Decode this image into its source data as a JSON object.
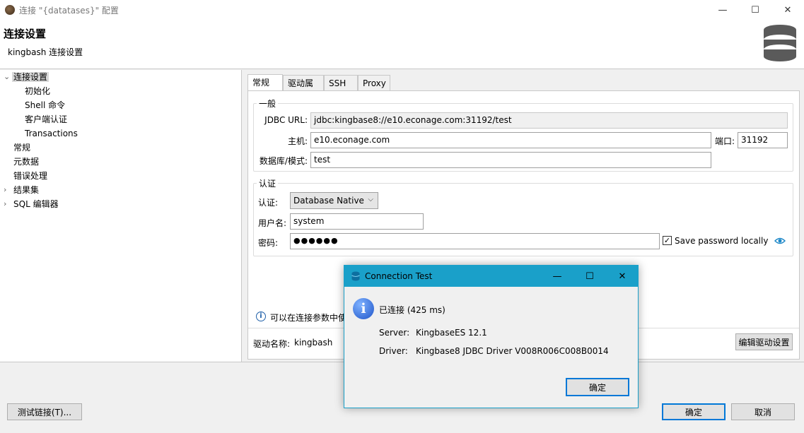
{
  "window": {
    "title": "连接 \"{datatases}\" 配置",
    "minimize": "—",
    "maximize": "☐",
    "close": "✕"
  },
  "header": {
    "title": "连接设置",
    "subtitle": "kingbash 连接设置"
  },
  "tree": {
    "items": [
      {
        "label": "连接设置",
        "level": 0,
        "expanded": true,
        "selected": true
      },
      {
        "label": "初始化",
        "level": 1
      },
      {
        "label": "Shell 命令",
        "level": 1
      },
      {
        "label": "客户端认证",
        "level": 1
      },
      {
        "label": "Transactions",
        "level": 1
      },
      {
        "label": "常规",
        "level": 0
      },
      {
        "label": "元数据",
        "level": 0
      },
      {
        "label": "错误处理",
        "level": 0
      },
      {
        "label": "结果集",
        "level": 0,
        "collapsed": true
      },
      {
        "label": "SQL 编辑器",
        "level": 0,
        "collapsed": true
      }
    ]
  },
  "tabs": [
    {
      "label": "常规",
      "active": true
    },
    {
      "label": "驱动属性"
    },
    {
      "label": "SSH"
    },
    {
      "label": "Proxy"
    }
  ],
  "general": {
    "group_label": "一般",
    "jdbc_label": "JDBC URL:",
    "jdbc_value": "jdbc:kingbase8://e10.econage.com:31192/test",
    "host_label": "主机:",
    "host_value": "e10.econage.com",
    "port_label": "端口:",
    "port_value": "31192",
    "db_label": "数据库/模式:",
    "db_value": "test"
  },
  "auth": {
    "group_label": "认证",
    "auth_label": "认证:",
    "auth_value": "Database Native",
    "user_label": "用户名:",
    "user_value": "system",
    "password_label": "密码:",
    "password_value": "●●●●●●",
    "save_password_label": "Save password locally",
    "save_password_checked": true
  },
  "hint": {
    "text": "可以在连接参数中使"
  },
  "driver": {
    "label": "驱动名称:",
    "value": "kingbash",
    "edit_button": "编辑驱动设置"
  },
  "footer": {
    "test_button": "测试链接(T)...",
    "ok_button": "确定",
    "cancel_button": "取消"
  },
  "dialog": {
    "title": "Connection Test",
    "status": "已连接 (425 ms)",
    "server_label": "Server:",
    "server_value": "KingbaseES 12.1",
    "driver_label": "Driver:",
    "driver_value": "Kingbase8 JDBC Driver V008R006C008B0014",
    "ok_button": "确定"
  },
  "colors": {
    "dialog_titlebar": "#1aa0c9",
    "default_button_border": "#0078d7",
    "eye_icon": "#1e88c8"
  }
}
